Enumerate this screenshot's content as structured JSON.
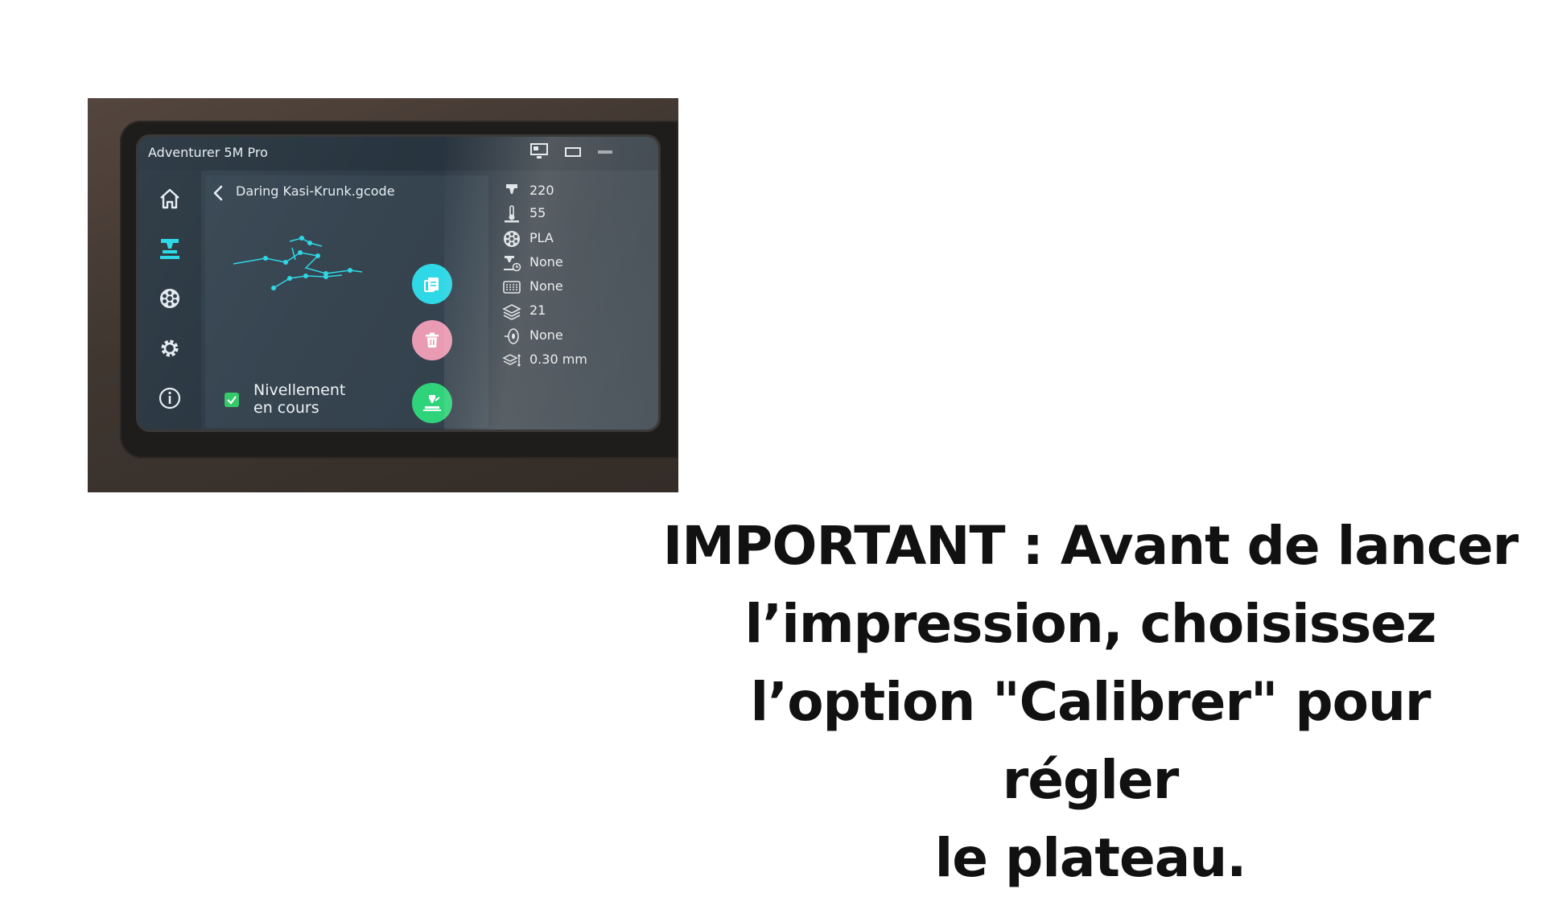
{
  "screen": {
    "app_title": "Adventurer 5M Pro",
    "file_title": "Daring Kasi-Krunk.gcode",
    "leveling_label_line1": "Nivellement",
    "leveling_label_line2": "en cours",
    "leveling_checked": true,
    "info": {
      "nozzle_temp": "220",
      "bed_temp": "55",
      "material": "PLA",
      "print_time": "None",
      "infill": "None",
      "layers": "21",
      "filament": "None",
      "layer_height": "0.30 mm"
    },
    "icons": {
      "top": [
        "monitor-icon",
        "usb-icon",
        "wifi-icon"
      ],
      "sidebar": [
        "home-icon",
        "printer-icon",
        "filament-icon",
        "settings-icon",
        "info-icon"
      ],
      "actions": [
        "copy-icon",
        "trash-icon",
        "print-icon"
      ]
    },
    "colors": {
      "accent_cyan": "#2fd8e6",
      "delete_pink": "#ea9bb4",
      "print_green": "#2fd47a",
      "check_green": "#36c96b"
    }
  },
  "headline": {
    "line1": "IMPORTANT : Avant de lancer",
    "line2": "l’impression, choisissez",
    "line3": "l’option \"Calibrer\" pour régler",
    "line4": "le plateau."
  }
}
